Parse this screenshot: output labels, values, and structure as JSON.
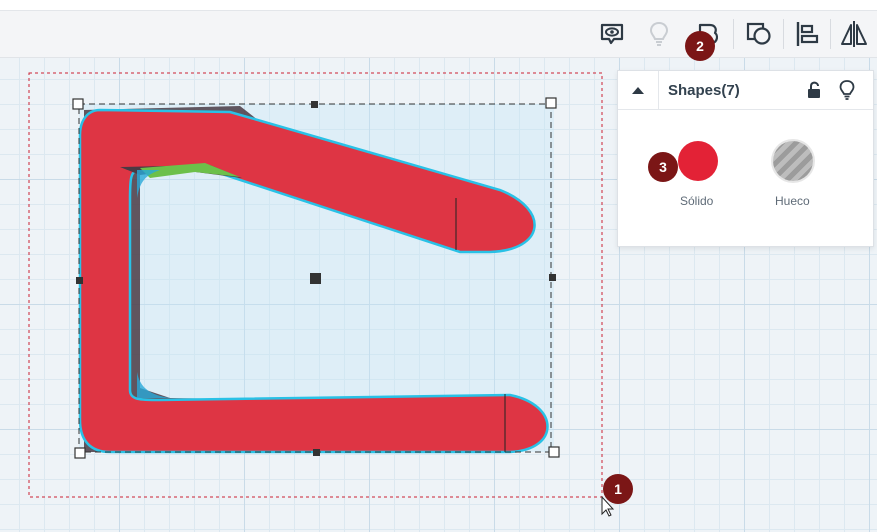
{
  "toolbar": {
    "buttons": [
      {
        "name": "show-all-view-button",
        "icon": "eye-speech-icon"
      },
      {
        "name": "toggle-lightbulb-button",
        "icon": "lightbulb-icon"
      },
      {
        "name": "notes-shape-button",
        "icon": "note-shape-icon"
      },
      {
        "name": "shape-outline-button",
        "icon": "shape-outline-icon"
      },
      {
        "name": "align-button",
        "icon": "align-left-icon"
      },
      {
        "name": "mirror-button",
        "icon": "mirror-icon"
      }
    ]
  },
  "shape_panel": {
    "title": "Shapes(7)",
    "solid_label": "Sólido",
    "hole_label": "Hueco",
    "solid_color": "#e32236"
  },
  "badges": {
    "b1": "1",
    "b2": "2",
    "b3": "3"
  },
  "colors": {
    "shape_fill": "#de3544",
    "shape_outline": "#29c1e6",
    "selection_box": "#333333",
    "workplane_selection": "#cc2233",
    "badge": "#7b1616"
  }
}
